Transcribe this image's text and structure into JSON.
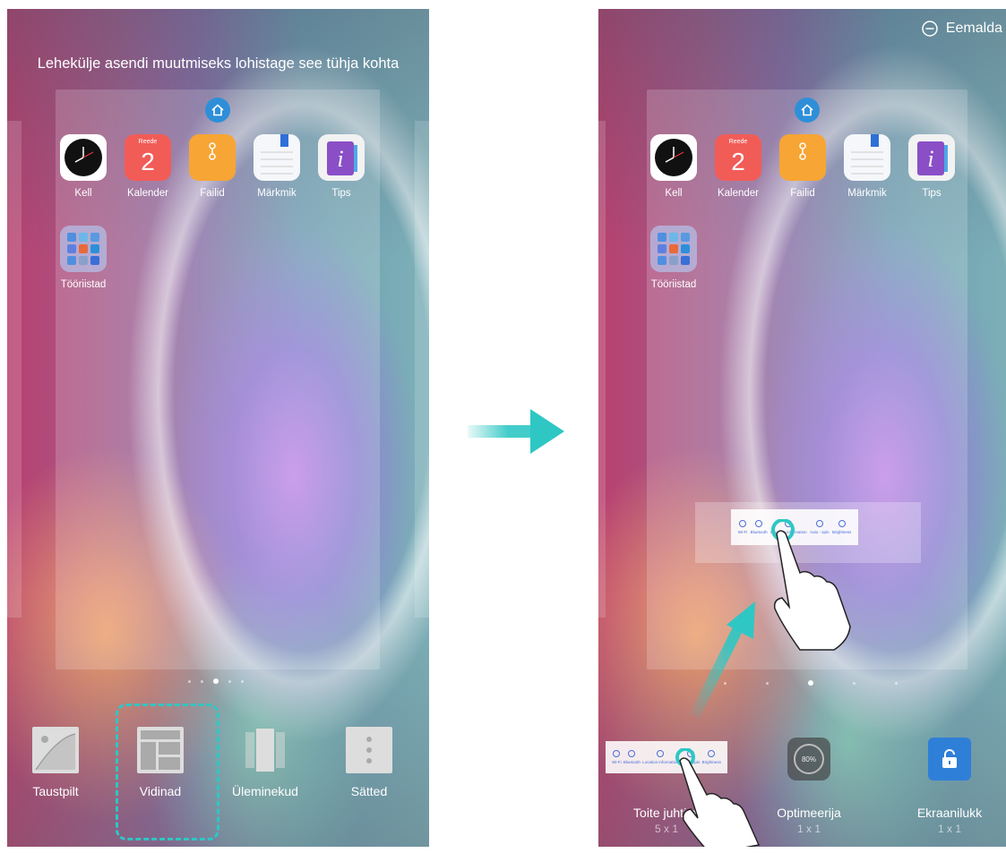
{
  "left": {
    "hint": "Lehekülje asendi muutmiseks lohistage see tühja kohta",
    "apps": [
      {
        "label": "Kell",
        "icon": "clock-icon"
      },
      {
        "label": "Kalender",
        "icon": "calendar-icon",
        "weekday": "Reede",
        "day": "2"
      },
      {
        "label": "Failid",
        "icon": "files-icon"
      },
      {
        "label": "Märkmik",
        "icon": "notepad-icon"
      },
      {
        "label": "Tips",
        "icon": "tips-icon"
      }
    ],
    "folder": {
      "label": "Tööriistad",
      "icon": "folder-icon"
    },
    "tools": [
      {
        "label": "Taustpilt",
        "icon": "wallpaper-icon"
      },
      {
        "label": "Vidinad",
        "icon": "widgets-icon"
      },
      {
        "label": "Üleminekud",
        "icon": "transitions-icon"
      },
      {
        "label": "Sätted",
        "icon": "settings-icon"
      }
    ],
    "selected_tool": "Vidinad"
  },
  "right": {
    "remove_label": "Eemalda",
    "apps": [
      {
        "label": "Kell",
        "icon": "clock-icon"
      },
      {
        "label": "Kalender",
        "icon": "calendar-icon",
        "weekday": "Reede",
        "day": "2"
      },
      {
        "label": "Failid",
        "icon": "files-icon"
      },
      {
        "label": "Märkmik",
        "icon": "notepad-icon"
      },
      {
        "label": "Tips",
        "icon": "tips-icon"
      }
    ],
    "folder": {
      "label": "Tööriistad",
      "icon": "folder-icon"
    },
    "widget_items": [
      "Wi-Fi",
      "Bluetooth",
      "Location information",
      "Auto - spin",
      "Brightness"
    ],
    "widgets": [
      {
        "label": "Toite juhtimi",
        "size": "5 x 1"
      },
      {
        "label": "Optimeerija",
        "size": "1 x 1",
        "value": "80%"
      },
      {
        "label": "Ekraanilukk",
        "size": "1 x 1"
      }
    ]
  },
  "colors": {
    "accent": "#2ec7c4",
    "home": "#2e8fd8",
    "calendar": "#f25c57",
    "files": "#f7a534",
    "lock": "#2e7fd8"
  }
}
